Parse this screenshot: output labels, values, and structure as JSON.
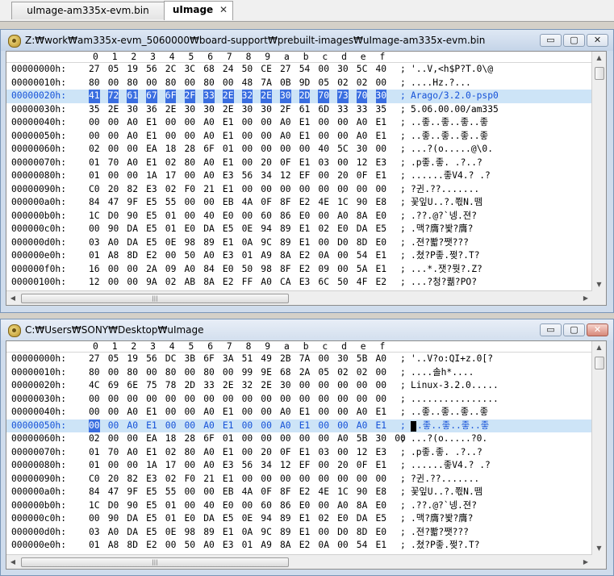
{
  "tabs": [
    {
      "label": "uImage-am335x-evm.bin",
      "active": false
    },
    {
      "label": "uImage",
      "active": true,
      "close": "✕"
    }
  ],
  "column_header": [
    "0",
    "1",
    "2",
    "3",
    "4",
    "5",
    "6",
    "7",
    "8",
    "9",
    "a",
    "b",
    "c",
    "d",
    "e",
    "f"
  ],
  "windows": [
    {
      "title": "Z:₩work₩am335x-evm_5060000₩board-support₩prebuilt-images₩uImage-am335x-evm.bin",
      "controls": {
        "minimize": "▭",
        "maximize": "▢",
        "close": "✕"
      },
      "highlight_row": 2,
      "selected": {
        "row": 2,
        "from": 0,
        "to": 15
      },
      "rows": [
        {
          "addr": "00000000h:",
          "bytes": [
            "27",
            "05",
            "19",
            "56",
            "2C",
            "3C",
            "68",
            "24",
            "50",
            "CE",
            "27",
            "54",
            "00",
            "30",
            "5C",
            "40"
          ],
          "ascii": "'..V,<h$P?T.0\\@"
        },
        {
          "addr": "00000010h:",
          "bytes": [
            "80",
            "00",
            "80",
            "00",
            "80",
            "00",
            "80",
            "00",
            "48",
            "7A",
            "0B",
            "9D",
            "05",
            "02",
            "02",
            "00"
          ],
          "ascii": "....Hz.?..."
        },
        {
          "addr": "00000020h:",
          "bytes": [
            "41",
            "72",
            "61",
            "67",
            "6F",
            "2F",
            "33",
            "2E",
            "32",
            "2E",
            "30",
            "2D",
            "70",
            "73",
            "70",
            "30"
          ],
          "ascii": "Arago/3.2.0-psp0"
        },
        {
          "addr": "00000030h:",
          "bytes": [
            "35",
            "2E",
            "30",
            "36",
            "2E",
            "30",
            "30",
            "2E",
            "30",
            "30",
            "2F",
            "61",
            "6D",
            "33",
            "33",
            "35"
          ],
          "ascii": "5.06.00.00/am335"
        },
        {
          "addr": "00000040h:",
          "bytes": [
            "00",
            "00",
            "A0",
            "E1",
            "00",
            "00",
            "A0",
            "E1",
            "00",
            "00",
            "A0",
            "E1",
            "00",
            "00",
            "A0",
            "E1"
          ],
          "ascii": "..좋..좋..좋..좋"
        },
        {
          "addr": "00000050h:",
          "bytes": [
            "00",
            "00",
            "A0",
            "E1",
            "00",
            "00",
            "A0",
            "E1",
            "00",
            "00",
            "A0",
            "E1",
            "00",
            "00",
            "A0",
            "E1"
          ],
          "ascii": "..좋..좋..좋..좋"
        },
        {
          "addr": "00000060h:",
          "bytes": [
            "02",
            "00",
            "00",
            "EA",
            "18",
            "28",
            "6F",
            "01",
            "00",
            "00",
            "00",
            "00",
            "40",
            "5C",
            "30",
            "00"
          ],
          "ascii": "...?(o.....@\\0."
        },
        {
          "addr": "00000070h:",
          "bytes": [
            "01",
            "70",
            "A0",
            "E1",
            "02",
            "80",
            "A0",
            "E1",
            "00",
            "20",
            "0F",
            "E1",
            "03",
            "00",
            "12",
            "E3"
          ],
          "ascii": ".p좋.좋. .?..?"
        },
        {
          "addr": "00000080h:",
          "bytes": [
            "01",
            "00",
            "00",
            "1A",
            "17",
            "00",
            "A0",
            "E3",
            "56",
            "34",
            "12",
            "EF",
            "00",
            "20",
            "0F",
            "E1"
          ],
          "ascii": "......좋V4.? .?"
        },
        {
          "addr": "00000090h:",
          "bytes": [
            "C0",
            "20",
            "82",
            "E3",
            "02",
            "F0",
            "21",
            "E1",
            "00",
            "00",
            "00",
            "00",
            "00",
            "00",
            "00",
            "00"
          ],
          "ascii": "?귄.??......."
        },
        {
          "addr": "000000a0h:",
          "bytes": [
            "84",
            "47",
            "9F",
            "E5",
            "55",
            "00",
            "00",
            "EB",
            "4A",
            "0F",
            "8F",
            "E2",
            "4E",
            "1C",
            "90",
            "E8"
          ],
          "ascii": "꽃잎U..?.쬓N.뗌"
        },
        {
          "addr": "000000b0h:",
          "bytes": [
            "1C",
            "D0",
            "90",
            "E5",
            "01",
            "00",
            "40",
            "E0",
            "00",
            "60",
            "86",
            "E0",
            "00",
            "A0",
            "8A",
            "E0"
          ],
          "ascii": ".??.@?`넹.젼?"
        },
        {
          "addr": "000000c0h:",
          "bytes": [
            "00",
            "90",
            "DA",
            "E5",
            "01",
            "E0",
            "DA",
            "E5",
            "0E",
            "94",
            "89",
            "E1",
            "02",
            "E0",
            "DA",
            "E5"
          ],
          "ascii": ".맥?膺?봧?膺?"
        },
        {
          "addr": "000000d0h:",
          "bytes": [
            "03",
            "A0",
            "DA",
            "E5",
            "0E",
            "98",
            "89",
            "E1",
            "0A",
            "9C",
            "89",
            "E1",
            "00",
            "D0",
            "8D",
            "E0"
          ],
          "ascii": ".젼?뽧?쨋???"
        },
        {
          "addr": "000000e0h:",
          "bytes": [
            "01",
            "A8",
            "8D",
            "E2",
            "00",
            "50",
            "A0",
            "E3",
            "01",
            "A9",
            "8A",
            "E2",
            "0A",
            "00",
            "54",
            "E1"
          ],
          "ascii": ".쳤?P좋.쩢?.T?"
        },
        {
          "addr": "000000f0h:",
          "bytes": [
            "16",
            "00",
            "00",
            "2A",
            "09",
            "A0",
            "84",
            "E0",
            "50",
            "98",
            "8F",
            "E2",
            "09",
            "00",
            "5A",
            "E1"
          ],
          "ascii": "...*.잿?뭣?.Z?"
        },
        {
          "addr": "00000100h:",
          "bytes": [
            "12",
            "00",
            "00",
            "9A",
            "02",
            "AB",
            "8A",
            "E2",
            "FF",
            "A0",
            "CA",
            "E3",
            "6C",
            "50",
            "4F",
            "E2"
          ],
          "ascii": "...?청?퀢?PO?"
        }
      ]
    },
    {
      "title": "C:₩Users₩SONY₩Desktop₩uImage",
      "controls": {
        "minimize": "▭",
        "maximize": "▢",
        "close": "✕"
      },
      "highlight_row": 5,
      "selected": {
        "row": 5,
        "from": 0,
        "to": 0
      },
      "rows": [
        {
          "addr": "00000000h:",
          "bytes": [
            "27",
            "05",
            "19",
            "56",
            "DC",
            "3B",
            "6F",
            "3A",
            "51",
            "49",
            "2B",
            "7A",
            "00",
            "30",
            "5B",
            "A0"
          ],
          "ascii": "'..V?o:QI+z.0[?"
        },
        {
          "addr": "00000010h:",
          "bytes": [
            "80",
            "00",
            "80",
            "00",
            "80",
            "00",
            "80",
            "00",
            "99",
            "9E",
            "68",
            "2A",
            "05",
            "02",
            "02",
            "00"
          ],
          "ascii": "....솔h*...."
        },
        {
          "addr": "00000020h:",
          "bytes": [
            "4C",
            "69",
            "6E",
            "75",
            "78",
            "2D",
            "33",
            "2E",
            "32",
            "2E",
            "30",
            "00",
            "00",
            "00",
            "00",
            "00"
          ],
          "ascii": "Linux-3.2.0....."
        },
        {
          "addr": "00000030h:",
          "bytes": [
            "00",
            "00",
            "00",
            "00",
            "00",
            "00",
            "00",
            "00",
            "00",
            "00",
            "00",
            "00",
            "00",
            "00",
            "00",
            "00"
          ],
          "ascii": "................"
        },
        {
          "addr": "00000040h:",
          "bytes": [
            "00",
            "00",
            "A0",
            "E1",
            "00",
            "00",
            "A0",
            "E1",
            "00",
            "00",
            "A0",
            "E1",
            "00",
            "00",
            "A0",
            "E1"
          ],
          "ascii": "..좋..좋..좋..좋"
        },
        {
          "addr": "00000050h:",
          "bytes": [
            "00",
            "00",
            "A0",
            "E1",
            "00",
            "00",
            "A0",
            "E1",
            "00",
            "00",
            "A0",
            "E1",
            "00",
            "00",
            "A0",
            "E1"
          ],
          "ascii": ".좋..좋..좋..좋"
        },
        {
          "addr": "00000060h:",
          "bytes": [
            "02",
            "00",
            "00",
            "EA",
            "18",
            "28",
            "6F",
            "01",
            "00",
            "00",
            "00",
            "00",
            "00",
            "A0",
            "5B",
            "30",
            "00"
          ],
          "ascii": "...?(o.....?0."
        },
        {
          "addr": "00000070h:",
          "bytes": [
            "01",
            "70",
            "A0",
            "E1",
            "02",
            "80",
            "A0",
            "E1",
            "00",
            "20",
            "0F",
            "E1",
            "03",
            "00",
            "12",
            "E3"
          ],
          "ascii": ".p좋.좋. .?..?"
        },
        {
          "addr": "00000080h:",
          "bytes": [
            "01",
            "00",
            "00",
            "1A",
            "17",
            "00",
            "A0",
            "E3",
            "56",
            "34",
            "12",
            "EF",
            "00",
            "20",
            "0F",
            "E1"
          ],
          "ascii": "......좋V4.? .?"
        },
        {
          "addr": "00000090h:",
          "bytes": [
            "C0",
            "20",
            "82",
            "E3",
            "02",
            "F0",
            "21",
            "E1",
            "00",
            "00",
            "00",
            "00",
            "00",
            "00",
            "00",
            "00"
          ],
          "ascii": "?귄.??......."
        },
        {
          "addr": "000000a0h:",
          "bytes": [
            "84",
            "47",
            "9F",
            "E5",
            "55",
            "00",
            "00",
            "EB",
            "4A",
            "0F",
            "8F",
            "E2",
            "4E",
            "1C",
            "90",
            "E8"
          ],
          "ascii": "꽃잎U..?.쬓N.뗌"
        },
        {
          "addr": "000000b0h:",
          "bytes": [
            "1C",
            "D0",
            "90",
            "E5",
            "01",
            "00",
            "40",
            "E0",
            "00",
            "60",
            "86",
            "E0",
            "00",
            "A0",
            "8A",
            "E0"
          ],
          "ascii": ".??.@?`넹.젼?"
        },
        {
          "addr": "000000c0h:",
          "bytes": [
            "00",
            "90",
            "DA",
            "E5",
            "01",
            "E0",
            "DA",
            "E5",
            "0E",
            "94",
            "89",
            "E1",
            "02",
            "E0",
            "DA",
            "E5"
          ],
          "ascii": ".맥?膺?봧?膺?"
        },
        {
          "addr": "000000d0h:",
          "bytes": [
            "03",
            "A0",
            "DA",
            "E5",
            "0E",
            "98",
            "89",
            "E1",
            "0A",
            "9C",
            "89",
            "E1",
            "00",
            "D0",
            "8D",
            "E0"
          ],
          "ascii": ".젼?뽧?쨋???"
        },
        {
          "addr": "000000e0h:",
          "bytes": [
            "01",
            "A8",
            "8D",
            "E2",
            "00",
            "50",
            "A0",
            "E3",
            "01",
            "A9",
            "8A",
            "E2",
            "0A",
            "00",
            "54",
            "E1"
          ],
          "ascii": ".쳤?P좋.쩢?.T?"
        }
      ]
    }
  ],
  "scroll": {
    "up": "▲",
    "down": "▼",
    "left": "◀",
    "right": "▶",
    "grip": "|||"
  }
}
